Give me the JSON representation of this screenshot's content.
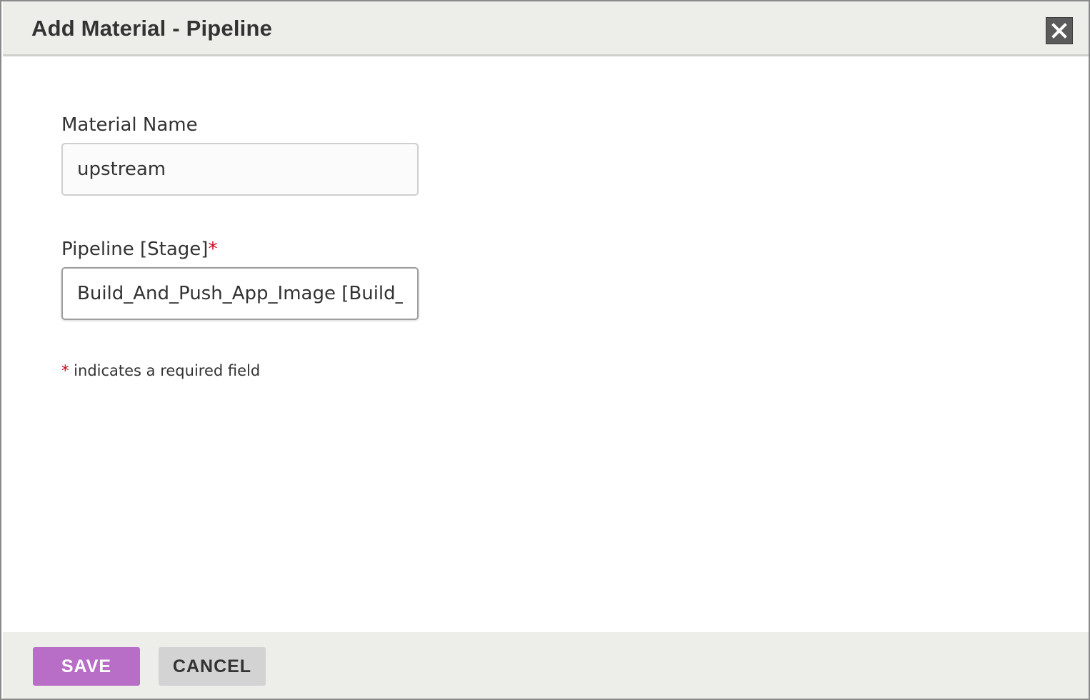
{
  "dialog": {
    "title": "Add Material - Pipeline",
    "close_icon": "close-icon"
  },
  "form": {
    "material_name": {
      "label": "Material Name",
      "value": "upstream"
    },
    "pipeline_stage": {
      "label": "Pipeline [Stage]",
      "required_marker": "*",
      "value": "Build_And_Push_App_Image [Build_Ar"
    },
    "required_note": {
      "marker": "*",
      "text": " indicates a required field"
    }
  },
  "footer": {
    "save_label": "SAVE",
    "cancel_label": "CANCEL"
  },
  "colors": {
    "header_bg": "#ededea",
    "save_button": "#b86ec6",
    "cancel_button": "#d3d3d3",
    "required_star": "#d0021b",
    "close_button": "#5b5b5b"
  }
}
